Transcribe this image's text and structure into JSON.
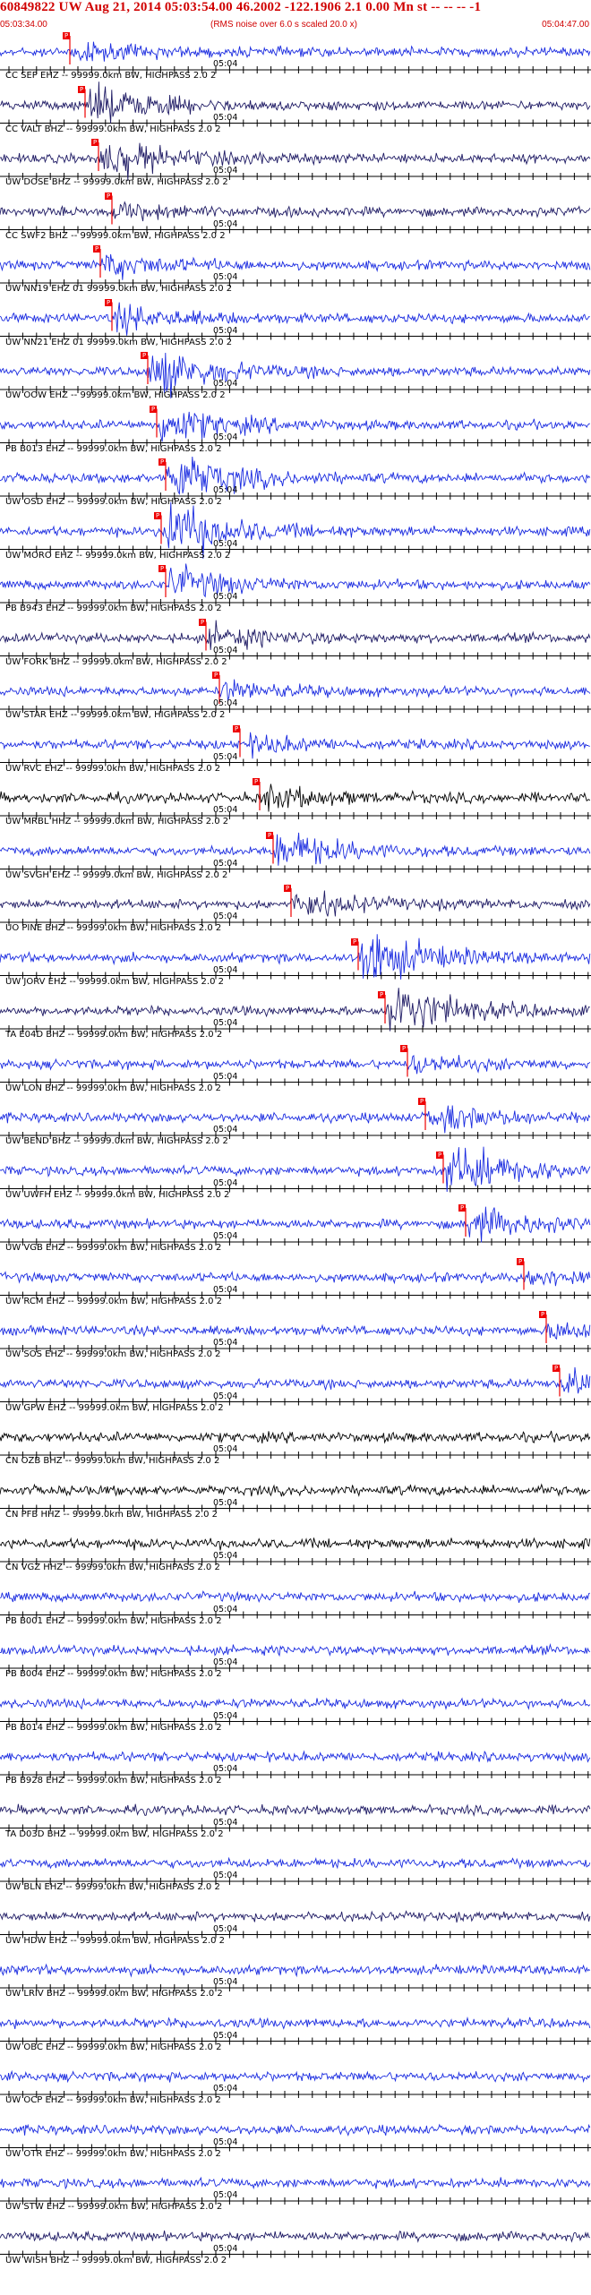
{
  "header": {
    "title": "60849822 UW Aug 21, 2014 05:03:54.00   46.2002 -122.1906  2.1 0.00 Mn st -- -- --  -1",
    "start_time": "05:03:34.00",
    "rms_note": "(RMS noise over 6.0 s scaled 20.0 x)",
    "end_time": "05:04:47.00"
  },
  "time_marker_label": "05:04",
  "colors": {
    "title_red": "#d00000",
    "trace_blue": "#1a2be0",
    "trace_navy": "#1e1a64",
    "trace_black": "#000000",
    "pick_red": "#ee0000"
  },
  "traces": [
    {
      "label": "CC SEP EHZ -- 99999.0km BW, HIGHPASS  2.0  2",
      "color": "trace_blue",
      "pick": "P"
    },
    {
      "label": "CC VALT BHZ -- 99999.0km BW, HIGHPASS  2.0  2",
      "color": "trace_navy",
      "pick": "P"
    },
    {
      "label": "UW DOSE BHZ -- 99999.0km BW, HIGHPASS  2.0  2",
      "color": "trace_navy",
      "pick": "P"
    },
    {
      "label": "CC SWF2 BHZ -- 99999.0km BW, HIGHPASS  2.0  2",
      "color": "trace_navy",
      "pick": "P"
    },
    {
      "label": "UW NN19 EHZ 01 99999.0km BW, HIGHPASS  2.0  2",
      "color": "trace_blue",
      "pick": "P"
    },
    {
      "label": "UW NN21 EHZ 01 99999.0km BW, HIGHPASS  2.0  2",
      "color": "trace_blue",
      "pick": "P"
    },
    {
      "label": "UW OOW EHZ -- 99999.0km BW, HIGHPASS  2.0  2",
      "color": "trace_blue",
      "pick": "P"
    },
    {
      "label": "PB B013 EHZ -- 99999.0km BW, HIGHPASS  2.0  2",
      "color": "trace_blue",
      "pick": "P"
    },
    {
      "label": "UW OSD EHZ -- 99999.0km BW, HIGHPASS  2.0  2",
      "color": "trace_blue",
      "pick": "P"
    },
    {
      "label": "UW MORO EHZ -- 99999.0km BW, HIGHPASS  2.0  2",
      "color": "trace_blue",
      "pick": "P"
    },
    {
      "label": "PB B943 EHZ -- 99999.0km BW, HIGHPASS  2.0  2",
      "color": "trace_blue",
      "pick": "P"
    },
    {
      "label": "UW FORK BHZ -- 99999.0km BW, HIGHPASS  2.0  2",
      "color": "trace_navy",
      "pick": "P"
    },
    {
      "label": "UW STAR EHZ -- 99999.0km BW, HIGHPASS  2.0  2",
      "color": "trace_blue",
      "pick": "P"
    },
    {
      "label": "UW RVC EHZ -- 99999.0km BW, HIGHPASS  2.0  2",
      "color": "trace_blue",
      "pick": "P"
    },
    {
      "label": "UW MRBL HHZ -- 99999.0km BW, HIGHPASS  2.0  2",
      "color": "trace_black",
      "pick": "P"
    },
    {
      "label": "UW SVGH EHZ -- 99999.0km BW, HIGHPASS  2.0  2",
      "color": "trace_blue",
      "pick": "P"
    },
    {
      "label": "UO PINE BHZ -- 99999.0km BW, HIGHPASS  2.0  2",
      "color": "trace_navy",
      "pick": "P"
    },
    {
      "label": "UW JORV EHZ -- 99999.0km BW, HIGHPASS  2.0  2",
      "color": "trace_blue",
      "pick": "P"
    },
    {
      "label": "TA E04D BHZ -- 99999.0km BW, HIGHPASS  2.0  2",
      "color": "trace_navy",
      "pick": "P"
    },
    {
      "label": "UW LON BHZ -- 99999.0km BW, HIGHPASS  2.0  2",
      "color": "trace_blue",
      "pick": "P"
    },
    {
      "label": "UW BEND BHZ -- 99999.0km BW, HIGHPASS  2.0  2",
      "color": "trace_blue",
      "pick": "P"
    },
    {
      "label": "UW UWFH EHZ -- 99999.0km BW, HIGHPASS  2.0  2",
      "color": "trace_blue",
      "pick": "P"
    },
    {
      "label": "UW VGB EHZ -- 99999.0km BW, HIGHPASS  2.0  2",
      "color": "trace_blue",
      "pick": "P"
    },
    {
      "label": "UW RCM EHZ -- 99999.0km BW, HIGHPASS  2.0  2",
      "color": "trace_blue",
      "pick": "P"
    },
    {
      "label": "UW SOS EHZ -- 99999.0km BW, HIGHPASS  2.0  2",
      "color": "trace_blue",
      "pick": "P"
    },
    {
      "label": "UW GPW EHZ -- 99999.0km BW, HIGHPASS  2.0  2",
      "color": "trace_blue",
      "pick": "P"
    },
    {
      "label": "CN OZB BHZ -- 99999.0km BW, HIGHPASS  2.0  2",
      "color": "trace_black",
      "pick": ""
    },
    {
      "label": "CN PFB HHZ -- 99999.0km BW, HIGHPASS  2.0  2",
      "color": "trace_black",
      "pick": ""
    },
    {
      "label": "CN VGZ HHZ -- 99999.0km BW, HIGHPASS  2.0  2",
      "color": "trace_black",
      "pick": ""
    },
    {
      "label": "PB B001 EHZ -- 99999.0km BW, HIGHPASS  2.0  2",
      "color": "trace_blue",
      "pick": ""
    },
    {
      "label": "PB B004 EHZ -- 99999.0km BW, HIGHPASS  2.0  2",
      "color": "trace_blue",
      "pick": ""
    },
    {
      "label": "PB B014 EHZ -- 99999.0km BW, HIGHPASS  2.0  2",
      "color": "trace_blue",
      "pick": ""
    },
    {
      "label": "PB B928 EHZ -- 99999.0km BW, HIGHPASS  2.0  2",
      "color": "trace_blue",
      "pick": ""
    },
    {
      "label": "TA D03D BHZ -- 99999.0km BW, HIGHPASS  2.0  2",
      "color": "trace_navy",
      "pick": ""
    },
    {
      "label": "UW BLN EHZ -- 99999.0km BW, HIGHPASS  2.0  2",
      "color": "trace_blue",
      "pick": ""
    },
    {
      "label": "UW HDW EHZ -- 99999.0km BW, HIGHPASS  2.0  2",
      "color": "trace_navy",
      "pick": ""
    },
    {
      "label": "UW LRIV BHZ -- 99999.0km BW, HIGHPASS  2.0  2",
      "color": "trace_blue",
      "pick": ""
    },
    {
      "label": "UW OBC EHZ -- 99999.0km BW, HIGHPASS  2.0  2",
      "color": "trace_blue",
      "pick": ""
    },
    {
      "label": "UW OCP EHZ -- 99999.0km BW, HIGHPASS  2.0  2",
      "color": "trace_blue",
      "pick": ""
    },
    {
      "label": "UW OTR EHZ -- 99999.0km BW, HIGHPASS  2.0  2",
      "color": "trace_blue",
      "pick": ""
    },
    {
      "label": "UW STW EHZ -- 99999.0km BW, HIGHPASS  2.0  2",
      "color": "trace_blue",
      "pick": ""
    },
    {
      "label": "UW WISH BHZ -- 99999.0km BW, HIGHPASS  2.0  2",
      "color": "trace_navy",
      "pick": ""
    }
  ]
}
